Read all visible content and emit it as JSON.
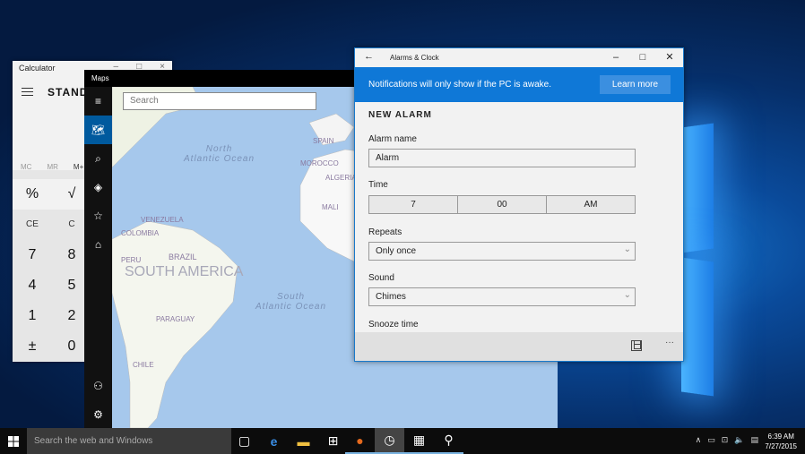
{
  "calculator": {
    "title": "Calculator",
    "mode": "STANDA",
    "memory": [
      "MC",
      "MR",
      "M+"
    ],
    "rows": [
      [
        "%",
        "√"
      ],
      [
        "CE",
        "C"
      ],
      [
        "7",
        "8"
      ],
      [
        "4",
        "5"
      ],
      [
        "1",
        "2"
      ],
      [
        "±",
        "0"
      ]
    ]
  },
  "maps": {
    "title": "Maps",
    "search_placeholder": "Search",
    "labels": {
      "north_atlantic": "North\nAtlantic Ocean",
      "south_atlantic": "South\nAtlantic Ocean",
      "south_america": "SOUTH AMERICA",
      "spain": "SPAIN",
      "morocco": "MOROCCO",
      "algeria": "ALGERIA",
      "mali": "MALI",
      "venezuela": "VENEZUELA",
      "colombia": "COLOMBIA",
      "peru": "PERU",
      "brazil": "BRAZIL",
      "paraguay": "PARAGUAY",
      "chile": "CHILE"
    }
  },
  "alarm": {
    "title": "Alarms & Clock",
    "banner_text": "Notifications will only show if the PC is awake.",
    "learn_more": "Learn more",
    "heading": "NEW ALARM",
    "name_label": "Alarm name",
    "name_value": "Alarm",
    "time_label": "Time",
    "time_hour": "7",
    "time_minute": "00",
    "time_ampm": "AM",
    "repeats_label": "Repeats",
    "repeats_value": "Only once",
    "sound_label": "Sound",
    "sound_value": "Chimes",
    "snooze_label": "Snooze time",
    "more": "···"
  },
  "taskbar": {
    "search_placeholder": "Search the web and Windows",
    "time": "6:39 AM",
    "date": "7/27/2015"
  }
}
